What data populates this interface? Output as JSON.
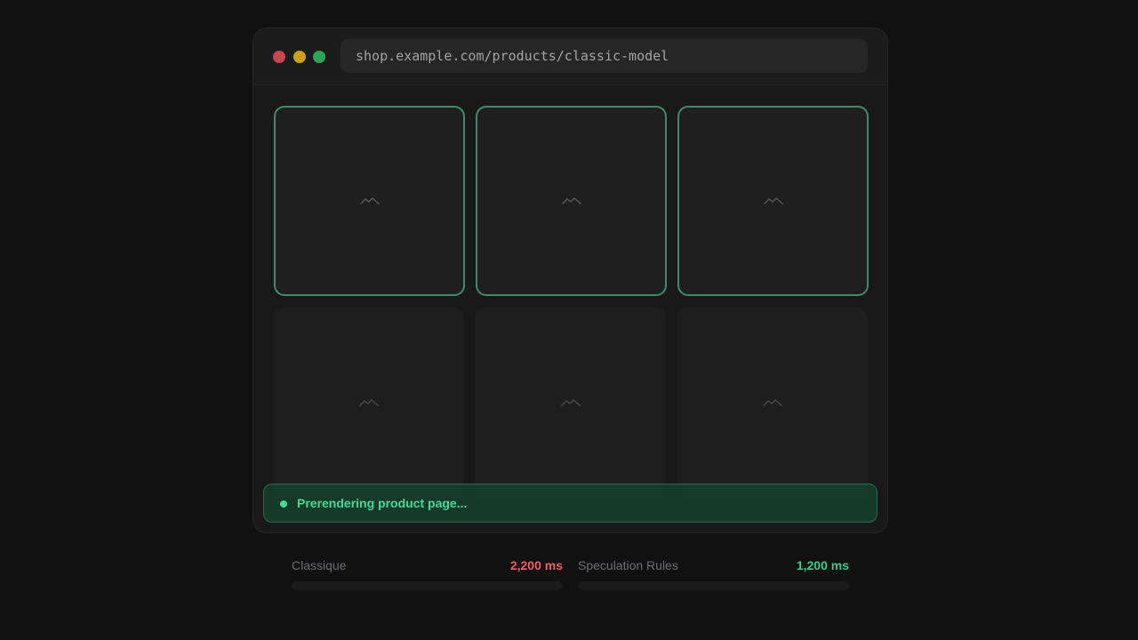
{
  "browser": {
    "url": "shop.example.com/products/classic-model",
    "traffic_lights": {
      "close": "#c9474e",
      "minimize": "#c9a11a",
      "maximize": "#2aa65a"
    }
  },
  "products": [
    {
      "icon": "image-placeholder-icon",
      "prefetched": true
    },
    {
      "icon": "image-placeholder-icon",
      "prefetched": true
    },
    {
      "icon": "image-placeholder-icon",
      "prefetched": true
    },
    {
      "icon": "image-placeholder-icon",
      "prefetched": false
    },
    {
      "icon": "image-placeholder-icon",
      "prefetched": false
    },
    {
      "icon": "image-placeholder-icon",
      "prefetched": false
    }
  ],
  "status": {
    "message": "Prerendering product page...",
    "color": "#3ddc97"
  },
  "metrics": [
    {
      "label": "Classique",
      "value": "2,200 ms",
      "color": "#ef5c63"
    },
    {
      "label": "Speculation Rules",
      "value": "1,200 ms",
      "color": "#2fd08c"
    }
  ]
}
